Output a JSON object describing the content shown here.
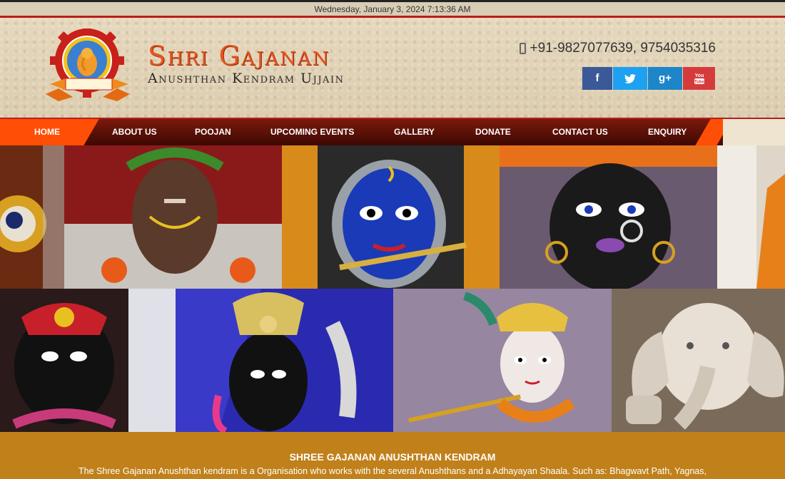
{
  "datebar": {
    "datetime": "Wednesday, January 3, 2024 7:13:36 AM"
  },
  "brand": {
    "title": "Shri Gajanan",
    "subtitle": "Anushthan Kendram Ujjain"
  },
  "contact": {
    "phone": "+91-9827077639, 9754035316",
    "phone_icon": "mobile-phone-icon"
  },
  "social": [
    {
      "label": "f",
      "icon": "facebook-icon"
    },
    {
      "label": "t",
      "icon": "twitter-icon"
    },
    {
      "label": "g+",
      "icon": "google-plus-icon"
    },
    {
      "label": "You",
      "icon": "youtube-icon"
    }
  ],
  "nav": [
    {
      "label": "HOME",
      "active": true
    },
    {
      "label": "ABOUT US"
    },
    {
      "label": "POOJAN"
    },
    {
      "label": "UPCOMING EVENTS"
    },
    {
      "label": "GALLERY"
    },
    {
      "label": "DONATE"
    },
    {
      "label": "CONTACT US"
    },
    {
      "label": "ENQUIRY"
    }
  ],
  "intro": {
    "heading": "SHREE GAJANAN ANUSHTHAN KENDRAM",
    "text": "The Shree Gajanan Anushthan kendram is a Organisation who works with the several Anushthans and a Adhayayan Shaala. Such as: Bhagwavt Path, Yagnas,"
  },
  "colors": {
    "accent": "#ff4e05",
    "brand_red": "#b5201a",
    "nav_dark": "#4a0d06",
    "footer": "#c0801a"
  }
}
